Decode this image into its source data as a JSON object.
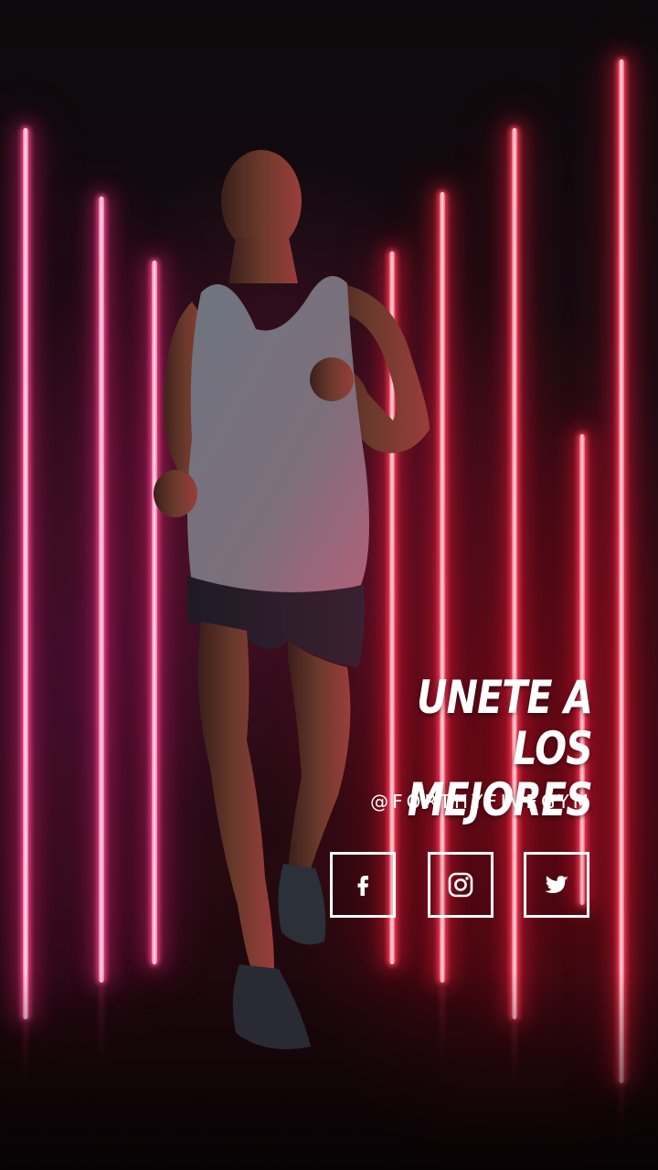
{
  "poster": {
    "headline_line1": "UNETE A LOS",
    "headline_line2": "MEJORES",
    "handle": "@FORTHYFIVEGYM"
  },
  "social": [
    {
      "network": "facebook",
      "icon": "facebook-icon"
    },
    {
      "network": "instagram",
      "icon": "instagram-icon"
    },
    {
      "network": "twitter",
      "icon": "twitter-icon"
    }
  ],
  "colors": {
    "neon_red": "#ff4a60",
    "neon_pink": "#ff6aa0",
    "text": "#ffffff",
    "background": "#120608"
  }
}
